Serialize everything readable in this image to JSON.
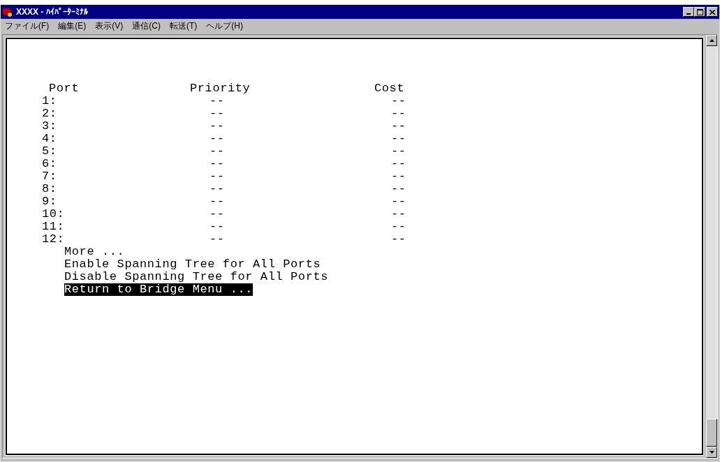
{
  "window": {
    "title": "XXXX - ﾊｲﾊﾟｰﾀｰﾐﾅﾙ"
  },
  "menu": [
    "ファイル(F)",
    "編集(E)",
    "表示(V)",
    "通信(C)",
    "転送(T)",
    "ヘルプ(H)"
  ],
  "table": {
    "columns": [
      "Port",
      "Priority",
      "Cost"
    ],
    "rows": [
      {
        "port": "1:",
        "priority": "--",
        "cost": "--"
      },
      {
        "port": "2:",
        "priority": "--",
        "cost": "--"
      },
      {
        "port": "3:",
        "priority": "--",
        "cost": "--"
      },
      {
        "port": "4:",
        "priority": "--",
        "cost": "--"
      },
      {
        "port": "5:",
        "priority": "--",
        "cost": "--"
      },
      {
        "port": "6:",
        "priority": "--",
        "cost": "--"
      },
      {
        "port": "7:",
        "priority": "--",
        "cost": "--"
      },
      {
        "port": "8:",
        "priority": "--",
        "cost": "--"
      },
      {
        "port": "9:",
        "priority": "--",
        "cost": "--"
      },
      {
        "port": "10:",
        "priority": "--",
        "cost": "--"
      },
      {
        "port": "11:",
        "priority": "--",
        "cost": "--"
      },
      {
        "port": "12:",
        "priority": "--",
        "cost": "--"
      }
    ]
  },
  "options": [
    {
      "label": "More ...",
      "selected": false
    },
    {
      "label": "Enable Spanning Tree for All Ports",
      "selected": false
    },
    {
      "label": "Disable Spanning Tree for All Ports",
      "selected": false
    },
    {
      "label": "Return to Bridge Menu ...",
      "selected": true
    }
  ]
}
